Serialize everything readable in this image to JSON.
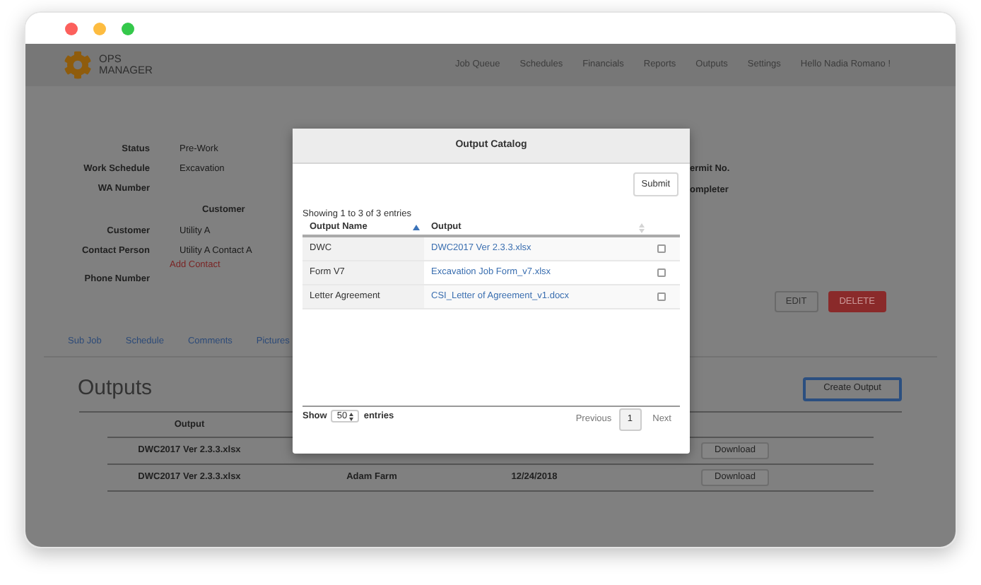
{
  "window": {
    "controls": [
      {
        "color": "#fc605c"
      },
      {
        "color": "#fdbc40"
      },
      {
        "color": "#34c84a"
      }
    ]
  },
  "nav": {
    "logo_lines": [
      "OPS",
      "MANAGER"
    ],
    "items": [
      "Job Queue",
      "Schedules",
      "Financials",
      "Reports",
      "Outputs",
      "Settings"
    ],
    "greeting": "Hello Nadia Romano !"
  },
  "details": {
    "rows": [
      {
        "kind": "field",
        "label": "Status",
        "value": "Pre-Work"
      },
      {
        "kind": "field",
        "label": "Work Schedule",
        "value": "Excavation"
      },
      {
        "kind": "field",
        "label": "WA Number"
      },
      {
        "kind": "heading",
        "label": "Customer"
      },
      {
        "kind": "field",
        "label": "Customer",
        "value": "Utility A"
      },
      {
        "kind": "field",
        "label": "Contact Person",
        "value": "Utility A Contact A",
        "link": "Add Contact"
      },
      {
        "kind": "field",
        "label": "Phone Number"
      }
    ],
    "right_labels": [
      "ermit No.",
      "ompleter"
    ],
    "actions": [
      {
        "label": "EDIT",
        "kind": "secondary"
      },
      {
        "label": "DELETE",
        "kind": "danger"
      }
    ]
  },
  "tabs": [
    "Sub Job",
    "Schedule",
    "Comments",
    "Pictures"
  ],
  "outputs": {
    "title": "Outputs",
    "create_button": "Create Output",
    "columns": [
      "Output"
    ],
    "rows": [
      {
        "output": "DWC2017 Ver 2.3.3.xlsx",
        "action": "Download"
      },
      {
        "output": "DWC2017 Ver 2.3.3.xlsx",
        "column_2": "Adam Farm",
        "column_3": "12/24/2018",
        "action": "Download"
      }
    ]
  },
  "modal": {
    "title": "Output Catalog",
    "submit": "Submit",
    "info": "Showing 1 to 3 of 3 entries",
    "columns": [
      {
        "label": "Output Name",
        "sorted": true
      },
      {
        "label": "Output",
        "sorted": false
      }
    ],
    "rows": [
      {
        "name": "DWC",
        "output": "DWC2017 Ver 2.3.3.xlsx",
        "checked": false
      },
      {
        "name": "Form V7",
        "output": "Excavation Job Form_v7.xlsx",
        "checked": false
      },
      {
        "name": "Letter Agreement",
        "output": "CSI_Letter of Agreement_v1.docx",
        "checked": false
      }
    ],
    "length": {
      "label_before": "Show",
      "value": "50",
      "label_after": "entries"
    },
    "pagination": {
      "previous": "Previous",
      "pages": [
        {
          "label": "1",
          "selected": true
        }
      ],
      "next": "Next"
    }
  }
}
